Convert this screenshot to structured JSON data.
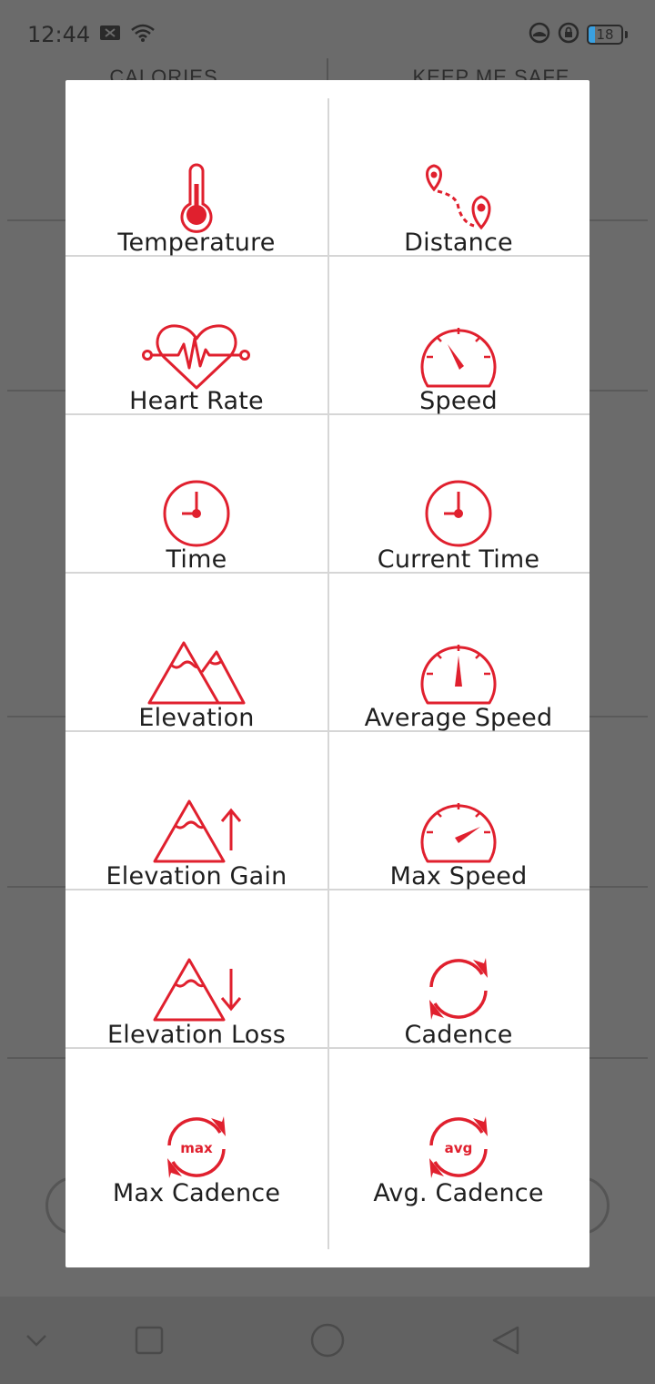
{
  "status_bar": {
    "time": "12:44",
    "battery_level": "18",
    "icons": [
      "message-icon",
      "wifi-icon",
      "data-saver-icon",
      "vpn-lock-icon",
      "battery-icon"
    ]
  },
  "background": {
    "left_header": "CALORIES",
    "right_header": "KEEP ME SAFE"
  },
  "colors": {
    "accent": "#e0202e",
    "overlay": "#6b6b6b",
    "dialog_bg": "#ffffff",
    "divider": "#d6d6d6",
    "label": "#1f1f1f"
  },
  "metrics": [
    {
      "label": "Temperature",
      "icon": "thermometer-icon"
    },
    {
      "label": "Distance",
      "icon": "route-pins-icon"
    },
    {
      "label": "Heart Rate",
      "icon": "heart-rate-icon"
    },
    {
      "label": "Speed",
      "icon": "speedometer-icon"
    },
    {
      "label": "Time",
      "icon": "clock-icon"
    },
    {
      "label": "Current Time",
      "icon": "clock-icon"
    },
    {
      "label": "Elevation",
      "icon": "mountains-icon"
    },
    {
      "label": "Average Speed",
      "icon": "speedometer-mid-icon"
    },
    {
      "label": "Elevation Gain",
      "icon": "mountain-up-icon"
    },
    {
      "label": "Max Speed",
      "icon": "speedometer-max-icon"
    },
    {
      "label": "Elevation Loss",
      "icon": "mountain-down-icon"
    },
    {
      "label": "Cadence",
      "icon": "cycle-arrows-icon"
    },
    {
      "label": "Max Cadence",
      "icon": "cycle-arrows-max-icon",
      "icon_text": "max"
    },
    {
      "label": "Avg. Cadence",
      "icon": "cycle-arrows-avg-icon",
      "icon_text": "avg"
    }
  ]
}
